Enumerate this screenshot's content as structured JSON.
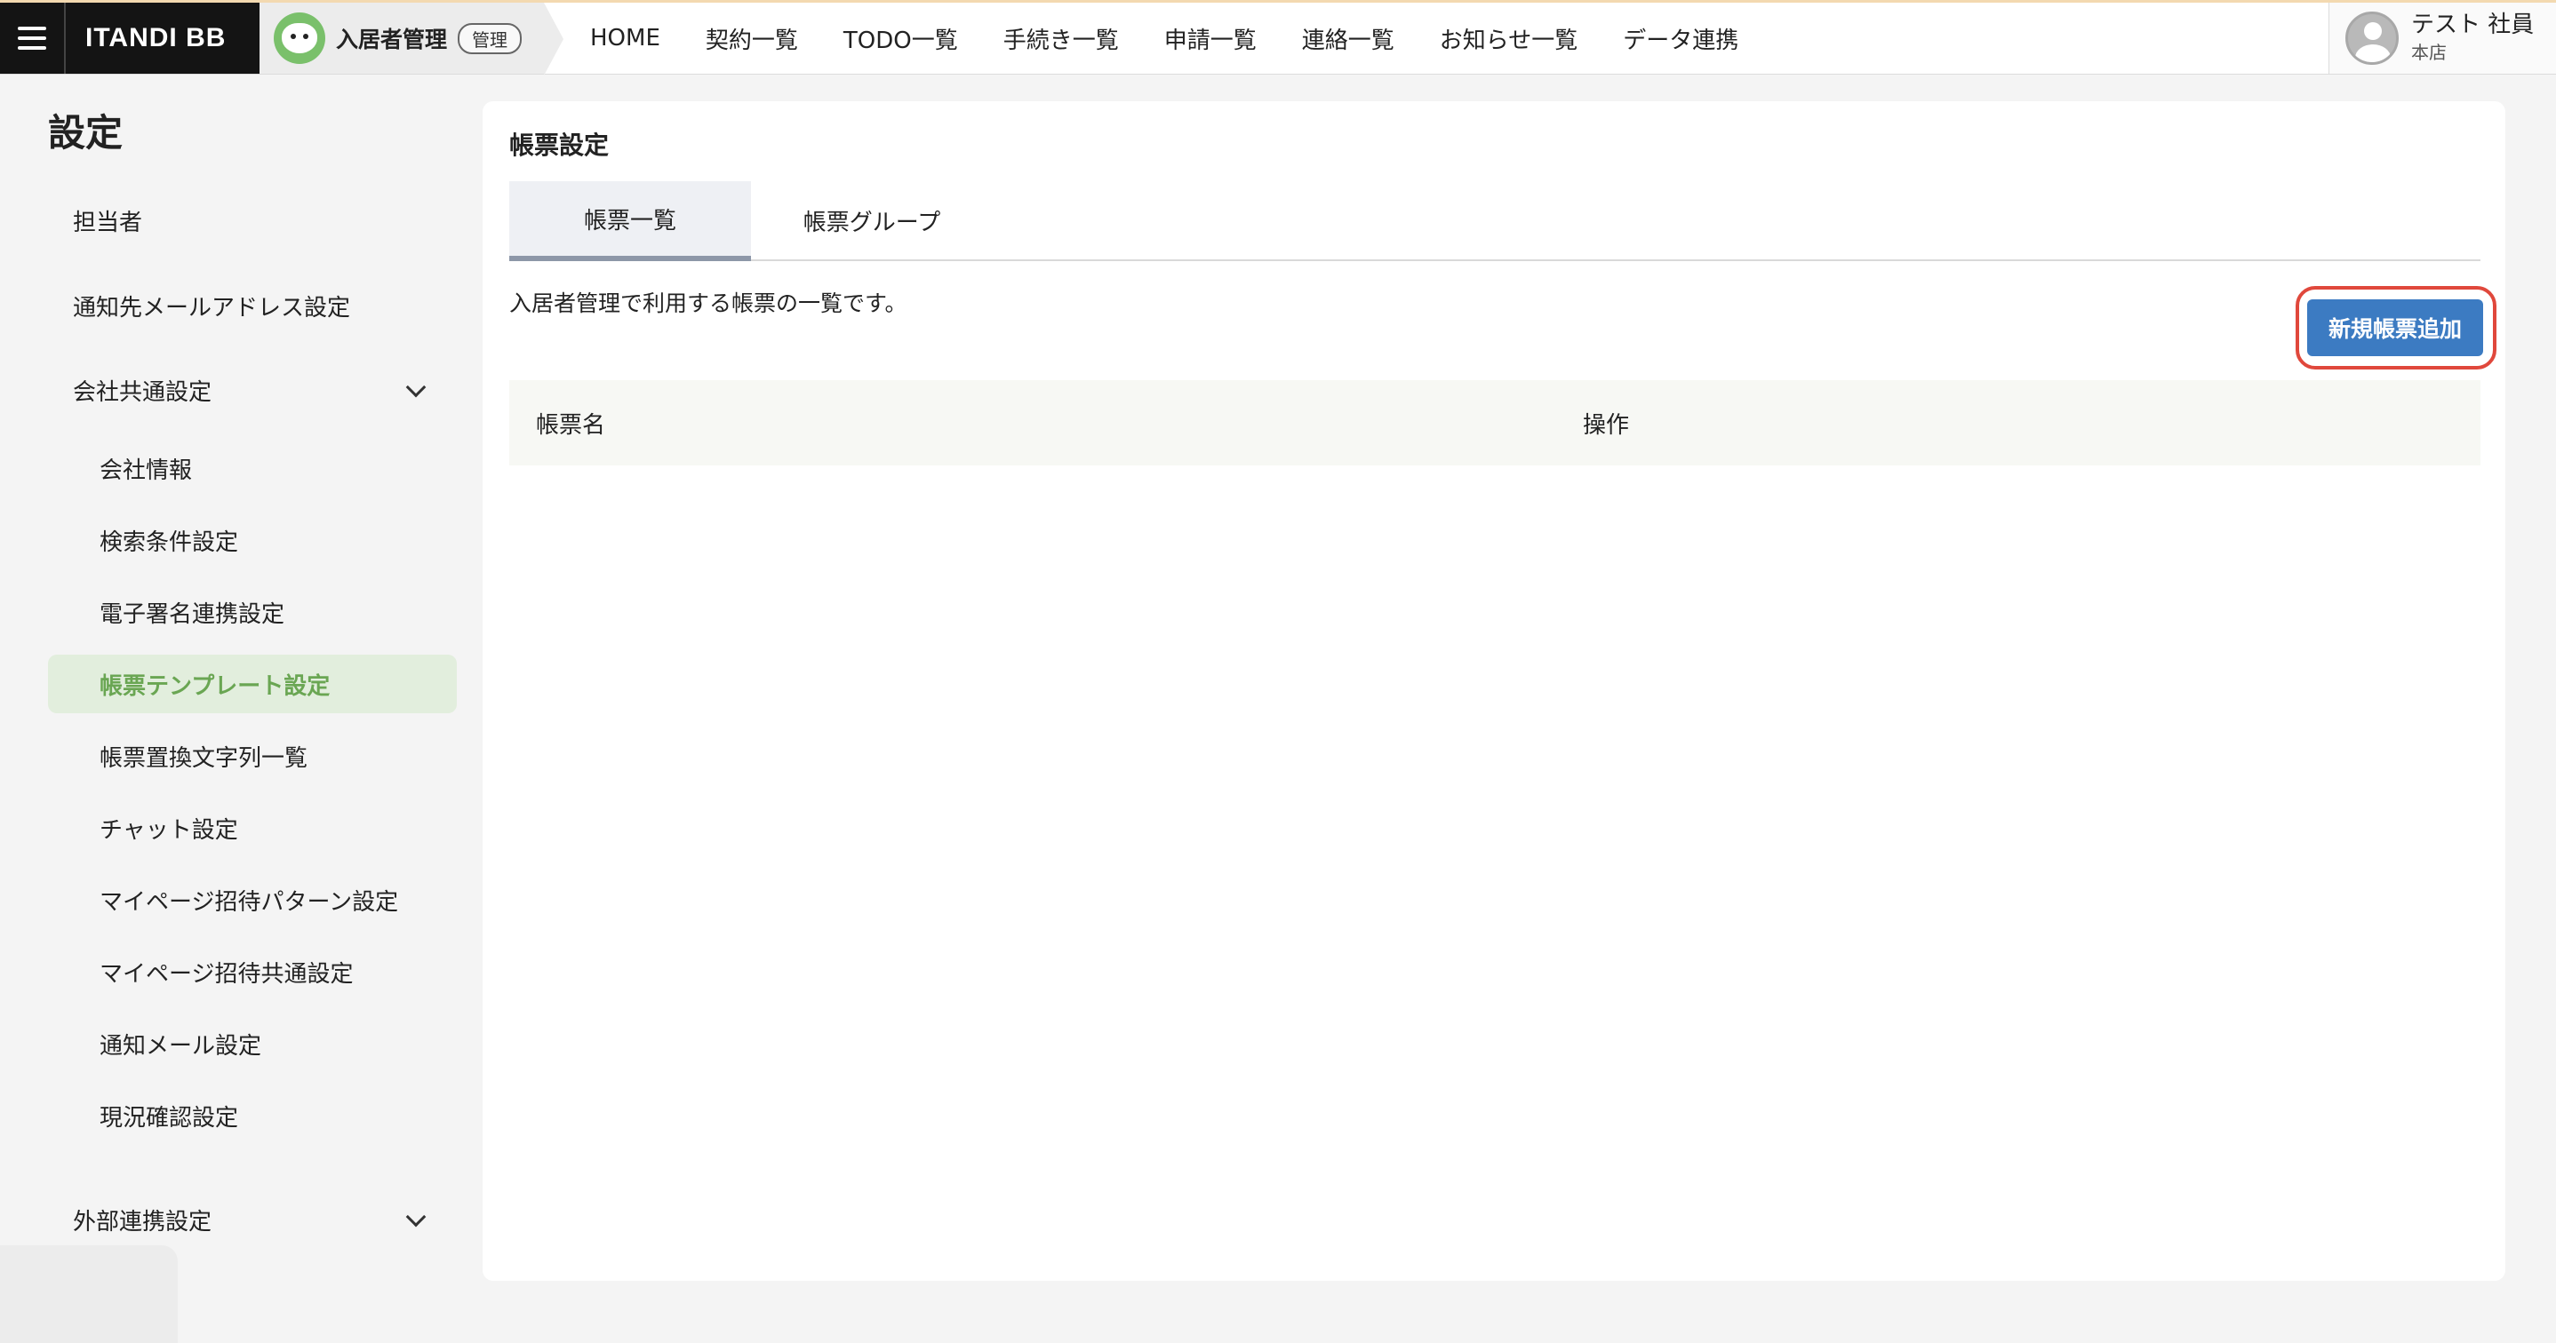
{
  "header": {
    "brand": "ITANDI BB",
    "app_name": "入居者管理",
    "admin_badge": "管理",
    "nav": [
      "HOME",
      "契約一覧",
      "TODO一覧",
      "手続き一覧",
      "申請一覧",
      "連絡一覧",
      "お知らせ一覧",
      "データ連携"
    ],
    "user_name": "テスト 社員",
    "user_branch": "本店"
  },
  "sidebar": {
    "title": "設定",
    "items": [
      {
        "label": "担当者"
      },
      {
        "label": "通知先メールアドレス設定"
      },
      {
        "label": "会社共通設定"
      },
      {
        "label": "会社情報"
      },
      {
        "label": "検索条件設定"
      },
      {
        "label": "電子署名連携設定"
      },
      {
        "label": "帳票テンプレート設定",
        "active": true
      },
      {
        "label": "帳票置換文字列一覧"
      },
      {
        "label": "チャット設定"
      },
      {
        "label": "マイページ招待パターン設定"
      },
      {
        "label": "マイページ招待共通設定"
      },
      {
        "label": "通知メール設定"
      },
      {
        "label": "現況確認設定"
      },
      {
        "label": "外部連携設定"
      }
    ]
  },
  "main": {
    "title": "帳票設定",
    "tabs": [
      {
        "label": "帳票一覧",
        "active": true
      },
      {
        "label": "帳票グループ"
      }
    ],
    "description": "入居者管理で利用する帳票の一覧です。",
    "add_button": "新規帳票追加",
    "table": {
      "columns": [
        "帳票名",
        "操作"
      ],
      "rows": []
    }
  },
  "colors": {
    "accent_green": "#6aa653",
    "primary_button": "#3c7bc2",
    "highlight_ring": "#e0483c"
  },
  "icons": {
    "menu": "hamburger-icon",
    "app_logo": "bear-logo-icon",
    "avatar": "user-avatar-icon",
    "expand": "chevron-down-icon"
  }
}
